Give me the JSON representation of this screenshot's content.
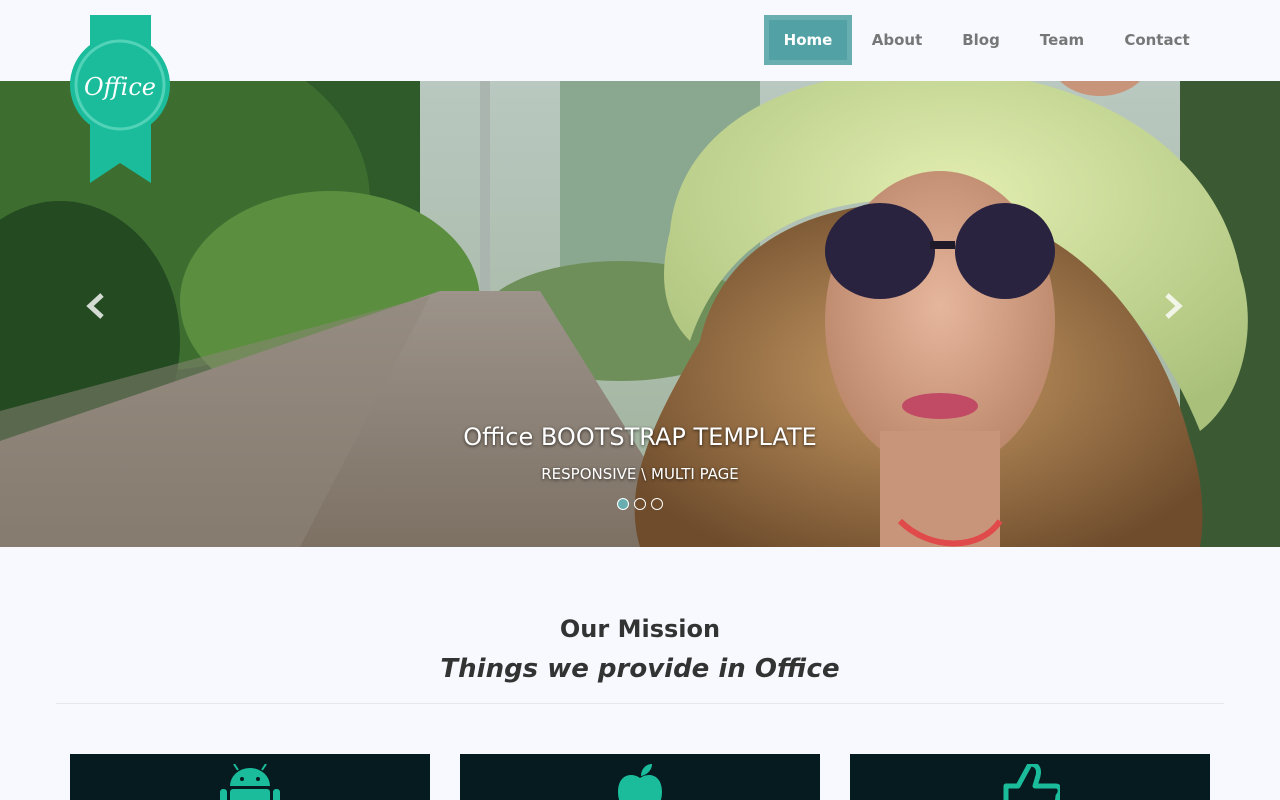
{
  "brand": {
    "logo_text": "Office",
    "accent": "#1abc9c",
    "nav_active_bg": "#52a1a4"
  },
  "nav": {
    "items": [
      {
        "label": "Home",
        "active": true
      },
      {
        "label": "About"
      },
      {
        "label": "Blog"
      },
      {
        "label": "Team"
      },
      {
        "label": "Contact"
      }
    ]
  },
  "carousel": {
    "title": "Office BOOTSTRAP TEMPLATE",
    "subtitle": "RESPONSIVE \\ MULTI PAGE",
    "slide_count": 3,
    "active_slide": 1,
    "prev_icon": "chevron-left-icon",
    "next_icon": "chevron-right-icon"
  },
  "mission": {
    "title": "Our Mission",
    "subtitle": "Things we provide in Office"
  },
  "services": [
    {
      "icon": "android-icon"
    },
    {
      "icon": "apple-icon"
    },
    {
      "icon": "thumbs-up-icon"
    }
  ]
}
